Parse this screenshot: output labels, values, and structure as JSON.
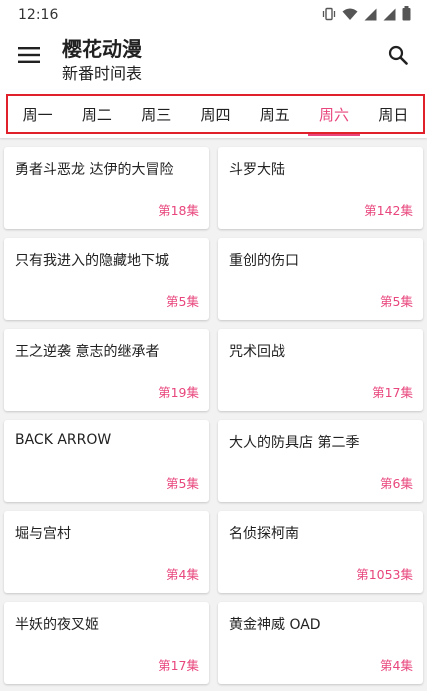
{
  "status_bar": {
    "time": "12:16",
    "icons": [
      "vibrate-icon",
      "wifi-icon",
      "signal-icon",
      "signal-icon",
      "battery-icon"
    ]
  },
  "app_bar": {
    "title": "樱花动漫",
    "subtitle": "新番时间表",
    "menu_icon": "menu-icon",
    "search_icon": "search-icon"
  },
  "tabs": {
    "items": [
      "周一",
      "周二",
      "周三",
      "周四",
      "周五",
      "周六",
      "周日"
    ],
    "active_index": 5
  },
  "shows": [
    {
      "title": "勇者斗恶龙 达伊的大冒险",
      "episode": "第18集"
    },
    {
      "title": "斗罗大陆",
      "episode": "第142集"
    },
    {
      "title": "只有我进入的隐藏地下城",
      "episode": "第5集"
    },
    {
      "title": "重创的伤口",
      "episode": "第5集"
    },
    {
      "title": "王之逆袭 意志的继承者",
      "episode": "第19集"
    },
    {
      "title": "咒术回战",
      "episode": "第17集"
    },
    {
      "title": "BACK ARROW",
      "episode": "第5集"
    },
    {
      "title": "大人的防具店 第二季",
      "episode": "第6集"
    },
    {
      "title": "堀与宫村",
      "episode": "第4集"
    },
    {
      "title": "名侦探柯南",
      "episode": "第1053集"
    },
    {
      "title": "半妖的夜叉姬",
      "episode": "第17集"
    },
    {
      "title": "黄金神威 OAD",
      "episode": "第4集"
    }
  ],
  "colors": {
    "accent": "#e8467c",
    "highlight_outline": "#e0212b",
    "background": "#f2f2f2"
  }
}
